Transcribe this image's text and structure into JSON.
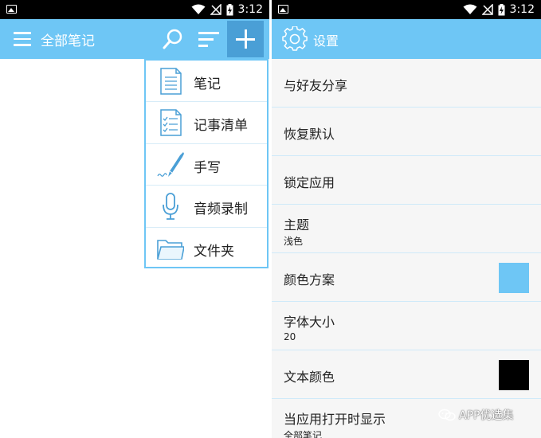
{
  "status_bar": {
    "time": "3:12"
  },
  "notes_screen": {
    "title": "全部笔记",
    "menu_icon": "hamburger-icon",
    "search_icon": "search-icon",
    "sort_icon": "sort-icon",
    "add_icon": "plus-icon",
    "dropdown": [
      {
        "label": "笔记",
        "icon": "note-icon"
      },
      {
        "label": "记事清单",
        "icon": "checklist-icon"
      },
      {
        "label": "手写",
        "icon": "pen-icon"
      },
      {
        "label": "音频录制",
        "icon": "microphone-icon"
      },
      {
        "label": "文件夹",
        "icon": "folder-icon"
      }
    ]
  },
  "settings_screen": {
    "title": "设置",
    "title_icon": "gear-icon",
    "items": [
      {
        "label": "与好友分享"
      },
      {
        "label": "恢复默认"
      },
      {
        "label": "锁定应用"
      },
      {
        "label": "主题",
        "value": "浅色"
      },
      {
        "label": "颜色方案",
        "swatch": "#6ec6f5"
      },
      {
        "label": "字体大小",
        "value": "20"
      },
      {
        "label": "文本颜色",
        "swatch": "#000000"
      },
      {
        "label": "当应用打开时显示",
        "value": "全部笔记"
      }
    ]
  },
  "watermark": {
    "text": "APP优选集"
  },
  "colors": {
    "accent": "#6ec6f5",
    "accent_dark": "#4a9fd6",
    "status_bar": "#000000"
  }
}
